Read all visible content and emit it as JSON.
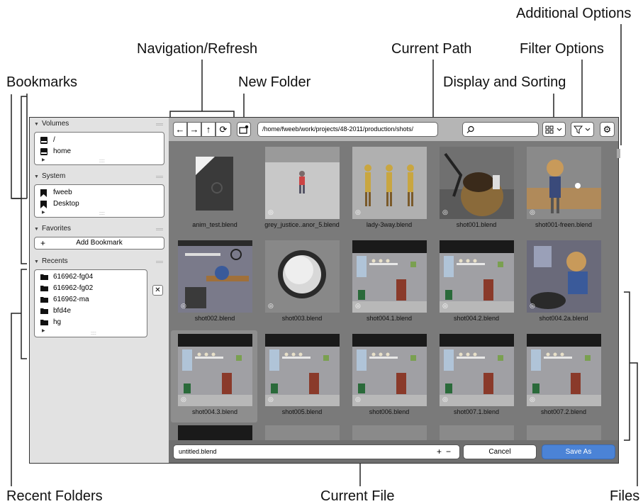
{
  "callouts": {
    "additional_options": "Additional Options",
    "navigation_refresh": "Navigation/Refresh",
    "current_path": "Current Path",
    "filter_options": "Filter Options",
    "bookmarks": "Bookmarks",
    "new_folder": "New Folder",
    "display_sorting": "Display and Sorting",
    "recent_folders": "Recent Folders",
    "current_file": "Current File",
    "files": "Files"
  },
  "sidebar": {
    "volumes": {
      "title": "Volumes",
      "items": [
        "/",
        "home"
      ]
    },
    "system": {
      "title": "System",
      "items": [
        "fweeb",
        "Desktop"
      ]
    },
    "favorites": {
      "title": "Favorites",
      "add_label": "Add Bookmark"
    },
    "recents": {
      "title": "Recents",
      "items": [
        "616962-fg04",
        "616962-fg02",
        "616962-ma",
        "bfd4e",
        "hg"
      ]
    }
  },
  "topbar": {
    "path": "/home/fweeb/work/projects/48-2011/production/shots/",
    "search_placeholder": ""
  },
  "files": [
    {
      "name": "anim_test.blend",
      "thumb": "doc"
    },
    {
      "name": "grey_justice..anor_5.blend",
      "thumb": "grey"
    },
    {
      "name": "lady-3way.blend",
      "thumb": "lady"
    },
    {
      "name": "shot001.blend",
      "thumb": "desk"
    },
    {
      "name": "shot001-freen.blend",
      "thumb": "desk2"
    },
    {
      "name": "shot002.blend",
      "thumb": "room"
    },
    {
      "name": "shot003.blend",
      "thumb": "knob"
    },
    {
      "name": "shot004.1.blend",
      "thumb": "shelf"
    },
    {
      "name": "shot004.2.blend",
      "thumb": "shelf"
    },
    {
      "name": "shot004.2a.blend",
      "thumb": "char"
    },
    {
      "name": "shot004.3.blend",
      "thumb": "shelf",
      "selected": true
    },
    {
      "name": "shot005.blend",
      "thumb": "shelf"
    },
    {
      "name": "shot006.blend",
      "thumb": "shelf"
    },
    {
      "name": "shot007.1.blend",
      "thumb": "shelf"
    },
    {
      "name": "shot007.2.blend",
      "thumb": "shelf"
    }
  ],
  "bottombar": {
    "filename": "untitled.blend",
    "cancel_label": "Cancel",
    "save_label": "Save As"
  }
}
